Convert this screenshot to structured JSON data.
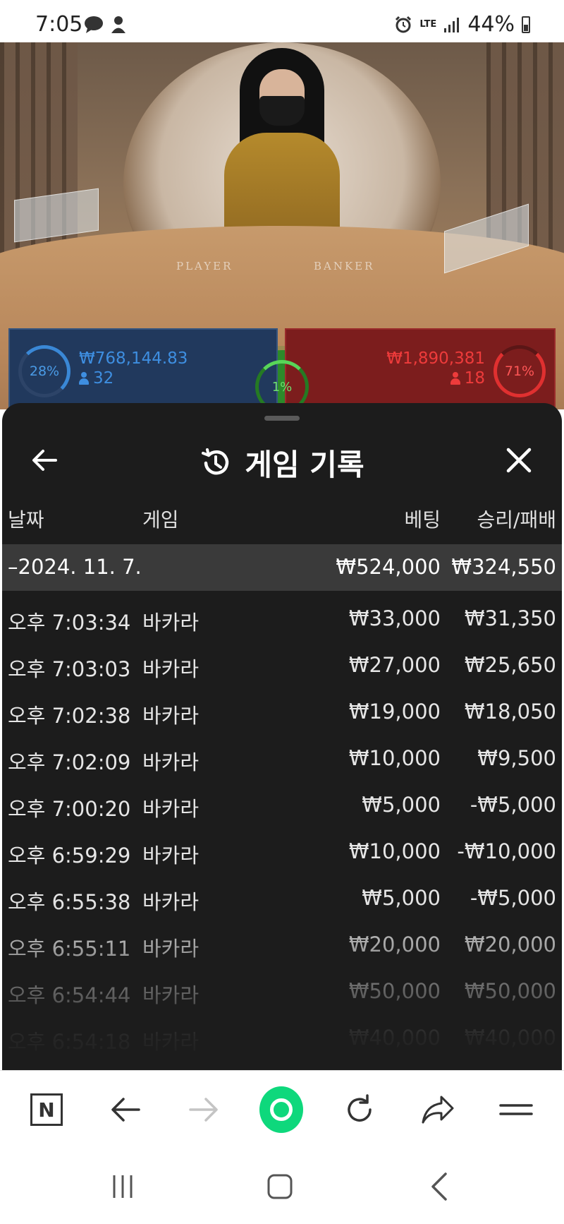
{
  "status_bar": {
    "time": "7:05",
    "network": "LTE",
    "battery": "44%",
    "left_icons": [
      "message-bubble-icon",
      "person-icon"
    ],
    "right_icons": [
      "alarm-icon",
      "lte-icon",
      "signal-icon",
      "battery-icon"
    ]
  },
  "video": {
    "table_player_label": "PLAYER",
    "table_banker_label": "BANKER",
    "player": {
      "percent": "28%",
      "amount": "₩768,144.83",
      "count": "32",
      "color": "#3e8ee0"
    },
    "tie": {
      "percent": "1%",
      "color": "#58d558"
    },
    "banker": {
      "percent": "71%",
      "amount": "₩1,890,381",
      "count": "18",
      "color": "#ee3b3b"
    }
  },
  "history": {
    "title": "게임 기록",
    "columns": {
      "date": "날짜",
      "game": "게임",
      "bet": "베팅",
      "result": "승리/패배"
    },
    "summary": {
      "date": "–2024. 11. 7.",
      "bet": "₩524,000",
      "result": "₩324,550"
    },
    "rows": [
      {
        "time": "오후 7:03:34",
        "game": "바카라",
        "bet": "₩33,000",
        "result": "₩31,350"
      },
      {
        "time": "오후 7:03:03",
        "game": "바카라",
        "bet": "₩27,000",
        "result": "₩25,650"
      },
      {
        "time": "오후 7:02:38",
        "game": "바카라",
        "bet": "₩19,000",
        "result": "₩18,050"
      },
      {
        "time": "오후 7:02:09",
        "game": "바카라",
        "bet": "₩10,000",
        "result": "₩9,500"
      },
      {
        "time": "오후 7:00:20",
        "game": "바카라",
        "bet": "₩5,000",
        "result": "-₩5,000"
      },
      {
        "time": "오후 6:59:29",
        "game": "바카라",
        "bet": "₩10,000",
        "result": "-₩10,000"
      },
      {
        "time": "오후 6:55:38",
        "game": "바카라",
        "bet": "₩5,000",
        "result": "-₩5,000"
      },
      {
        "time": "오후 6:55:11",
        "game": "바카라",
        "bet": "₩20,000",
        "result": "₩20,000"
      },
      {
        "time": "오후 6:54:44",
        "game": "바카라",
        "bet": "₩50,000",
        "result": "₩50,000"
      },
      {
        "time": "오후 6:54:18",
        "game": "바카라",
        "bet": "₩40,000",
        "result": "₩40,000"
      }
    ]
  },
  "browser_bar": {
    "buttons": [
      "naver-n-icon",
      "back-arrow-icon",
      "forward-arrow-icon",
      "home-green-icon",
      "refresh-icon",
      "share-icon",
      "menu-icon"
    ],
    "naver_letter": "N"
  },
  "nav_bar": {
    "buttons": [
      "recents-icon",
      "home-icon",
      "back-icon"
    ]
  }
}
